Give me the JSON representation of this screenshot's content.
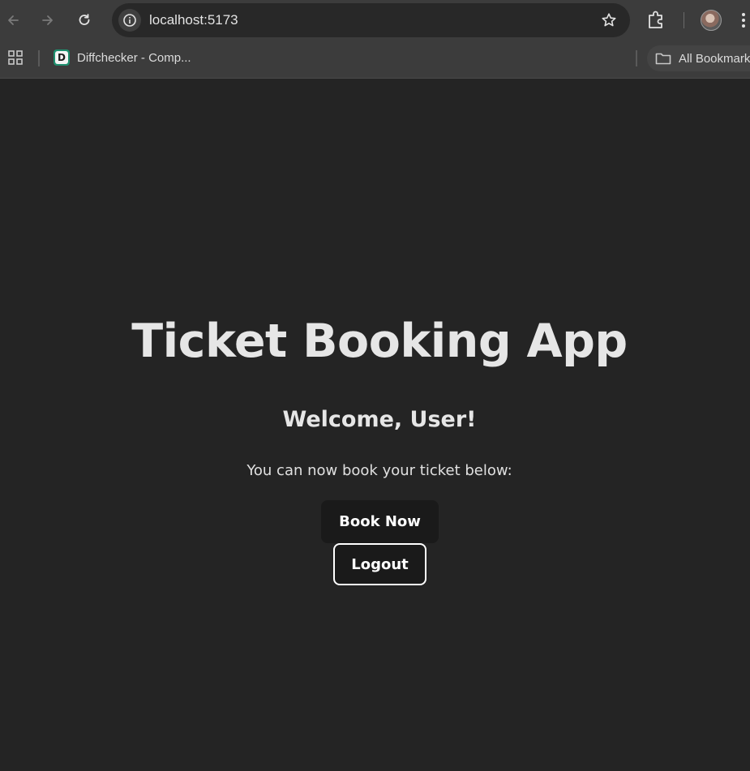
{
  "browser": {
    "url": "localhost:5173",
    "bookmarks": [
      {
        "label": "Diffchecker - Comp...",
        "favicon_letter": "D",
        "favicon_color": "#1e8f6e"
      }
    ],
    "all_bookmarks_label": "All Bookmarks",
    "icons": [
      "back-icon",
      "forward-icon",
      "reload-icon",
      "site-info-icon",
      "star-icon",
      "extensions-icon",
      "profile-avatar",
      "menu-icon",
      "apps-icon",
      "folder-icon"
    ]
  },
  "page": {
    "title": "Ticket Booking App",
    "welcome": "Welcome, User!",
    "subtitle": "You can now book your ticket below:",
    "book_button": "Book Now",
    "logout_button": "Logout"
  },
  "colors": {
    "background": "#242424",
    "text": "#e6e6e6",
    "button_bg": "#1a1a1a",
    "logout_border": "#ffffff"
  }
}
